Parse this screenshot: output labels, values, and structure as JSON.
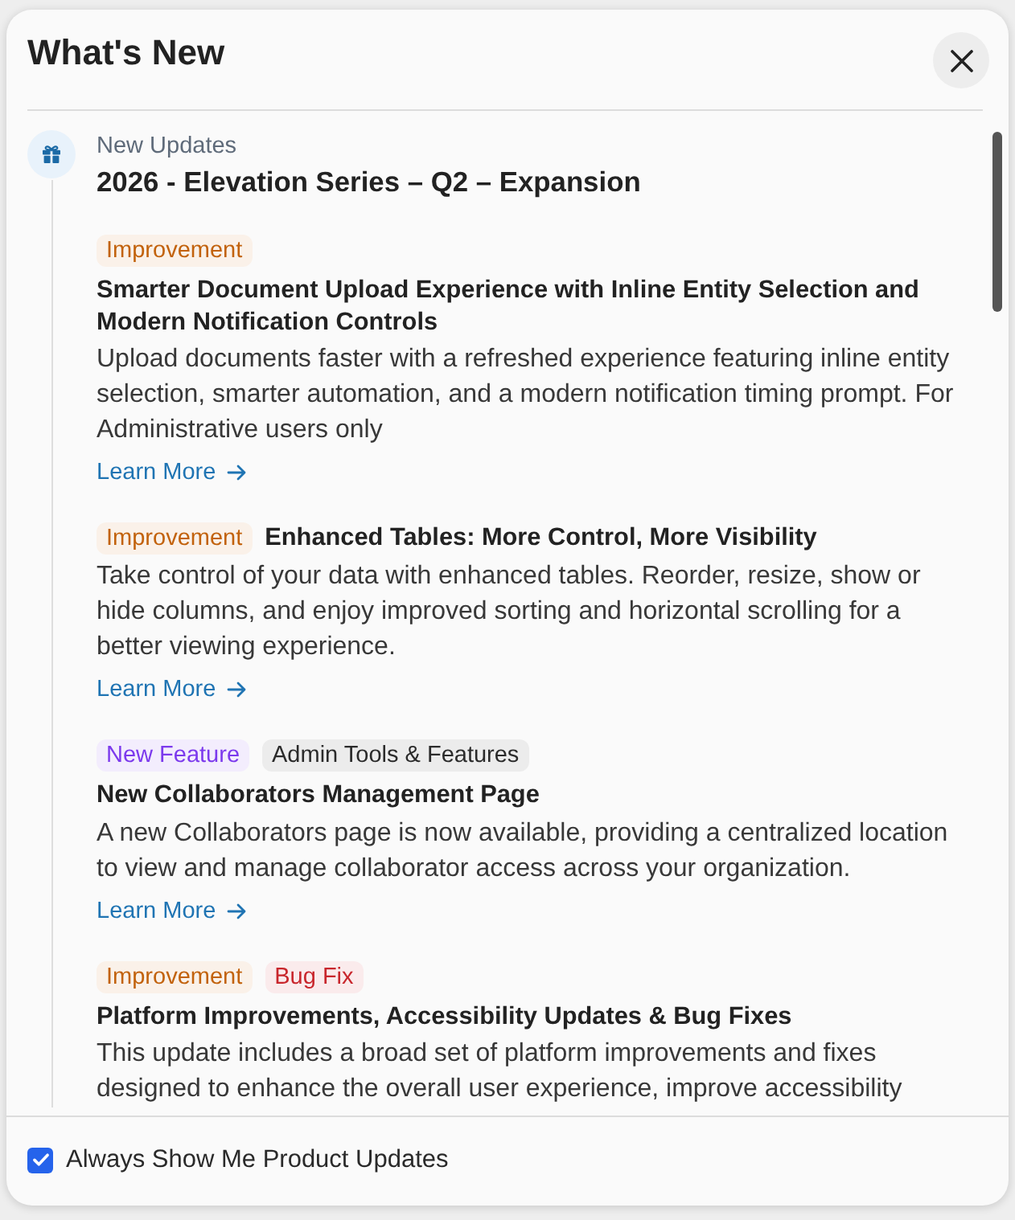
{
  "dialog": {
    "title": "What's New"
  },
  "section": {
    "label": "New Updates",
    "title": "2026 - Elevation Series – Q2 – Expansion"
  },
  "updates": [
    {
      "tags": [
        {
          "label": "Improvement",
          "color": "#c2620c"
        }
      ],
      "title": "Smarter Document Upload Experience with Inline Entity Selection and Modern Notification Controls",
      "description": "Upload documents faster with a refreshed experience featuring inline entity selection, smarter automation, and a modern notification timing prompt. For Administrative users only",
      "link": "Learn More"
    },
    {
      "tags": [
        {
          "label": "Improvement",
          "color": "#c2620c"
        }
      ],
      "title": "Enhanced Tables: More Control, More Visibility",
      "description": "Take control of your data with enhanced tables. Reorder, resize, show or hide columns, and enjoy improved sorting and horizontal scrolling for a better viewing experience.",
      "link": "Learn More"
    },
    {
      "tags": [
        {
          "label": "New Feature",
          "color": "#7c3aed"
        },
        {
          "label": "Admin Tools & Features",
          "color": "#2b2b2b"
        }
      ],
      "title": "New Collaborators Management Page",
      "description": "A new Collaborators page is now available, providing a centralized location to view and manage collaborator access across your organization.",
      "link": "Learn More"
    },
    {
      "tags": [
        {
          "label": "Improvement",
          "color": "#c2620c"
        },
        {
          "label": "Bug Fix",
          "color": "#c8262c"
        }
      ],
      "title": "Platform Improvements, Accessibility Updates & Bug Fixes",
      "description": "This update includes a broad set of platform improvements and fixes designed to enhance the overall user experience, improve accessibility"
    }
  ],
  "footer": {
    "checkbox": {
      "label": "Always Show Me Product Updates",
      "checked": true
    }
  }
}
